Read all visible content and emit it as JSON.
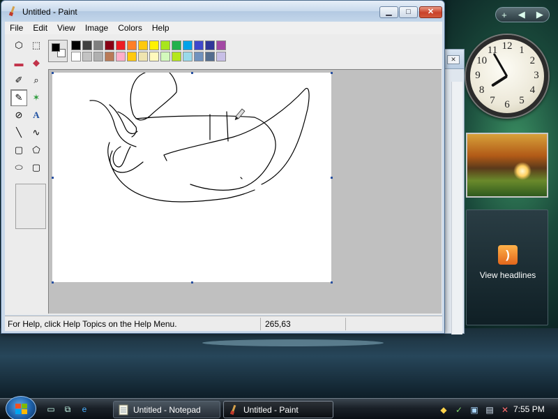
{
  "paint": {
    "title": "Untitled - Paint",
    "window_buttons": {
      "minimize": "▁",
      "maximize": "□",
      "close": "✕"
    },
    "menu": [
      "File",
      "Edit",
      "View",
      "Image",
      "Colors",
      "Help"
    ],
    "tools": [
      {
        "name": "free-form-select",
        "glyph": "⬡"
      },
      {
        "name": "select",
        "glyph": "⬚"
      },
      {
        "name": "eraser",
        "glyph": "▬"
      },
      {
        "name": "fill-with-color",
        "glyph": "◆"
      },
      {
        "name": "pick-color",
        "glyph": "✐"
      },
      {
        "name": "magnifier",
        "glyph": "⌕"
      },
      {
        "name": "pencil",
        "glyph": "✎"
      },
      {
        "name": "brush",
        "glyph": "✶"
      },
      {
        "name": "airbrush",
        "glyph": "⊘"
      },
      {
        "name": "text",
        "glyph": "A"
      },
      {
        "name": "line",
        "glyph": "╲"
      },
      {
        "name": "curve",
        "glyph": "∿"
      },
      {
        "name": "rectangle",
        "glyph": "▢"
      },
      {
        "name": "polygon",
        "glyph": "⬠"
      },
      {
        "name": "ellipse",
        "glyph": "⬭"
      },
      {
        "name": "rounded-rectangle",
        "glyph": "▢"
      }
    ],
    "active_tool": "pencil",
    "foreground_color": "#000000",
    "background_color": "#ffffff",
    "palette": [
      "#000000",
      "#404040",
      "#7f7f7f",
      "#880015",
      "#ed1c24",
      "#ff7f27",
      "#ffc90e",
      "#fff200",
      "#a8e61d",
      "#22b14c",
      "#00a2e8",
      "#3f48cc",
      "#2f3699",
      "#a349a4",
      "#ffffff",
      "#c3c3c3",
      "#b0b0b0",
      "#b97a57",
      "#ffaec9",
      "#ffc90e",
      "#efe4b0",
      "#fff9bd",
      "#d3f9bc",
      "#b5e61d",
      "#99d9ea",
      "#7092be",
      "#546d8e",
      "#c8bfe7"
    ],
    "status": {
      "help": "For Help, click Help Topics on the Help Menu.",
      "coords": "265,63"
    }
  },
  "notepad_back": {
    "close": "✕"
  },
  "sidebar": {
    "controls": [
      "+",
      "◀",
      "▶"
    ],
    "clock_numbers": [
      "12",
      "1",
      "2",
      "3",
      "4",
      "5",
      "6",
      "7",
      "8",
      "9",
      "10",
      "11"
    ],
    "clock_time": {
      "hour": 7,
      "minute": 55
    },
    "feed_label": "View headlines"
  },
  "taskbar": {
    "tasks": [
      {
        "label": "Untitled - Notepad",
        "icon": "notepad-icon"
      },
      {
        "label": "Untitled - Paint",
        "icon": "paint-icon"
      }
    ],
    "clock": "7:55 PM"
  }
}
